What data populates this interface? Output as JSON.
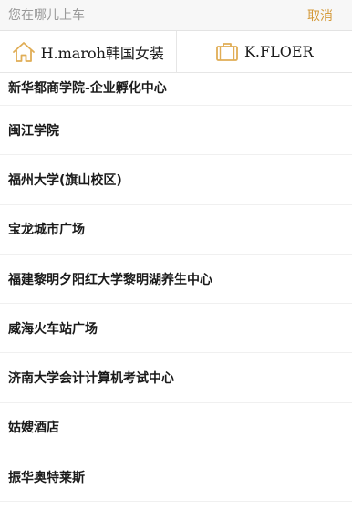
{
  "search": {
    "placeholder": "您在哪儿上车",
    "value": ""
  },
  "header": {
    "cancel_label": "取消"
  },
  "shortcuts": [
    {
      "label": "H.maroh韩国女装",
      "icon": "home-icon"
    },
    {
      "label": "K.FLOER",
      "icon": "briefcase-icon"
    }
  ],
  "results": [
    "新华都商学院-企业孵化中心",
    "闽江学院",
    "福州大学(旗山校区)",
    "宝龙城市广场",
    "福建黎明夕阳红大学黎明湖养生中心",
    "威海火车站广场",
    "济南大学会计计算机考试中心",
    "姑嫂酒店",
    "振华奥特莱斯"
  ],
  "colors": {
    "accent": "#d49a3a",
    "icon": "#e0ad55"
  }
}
